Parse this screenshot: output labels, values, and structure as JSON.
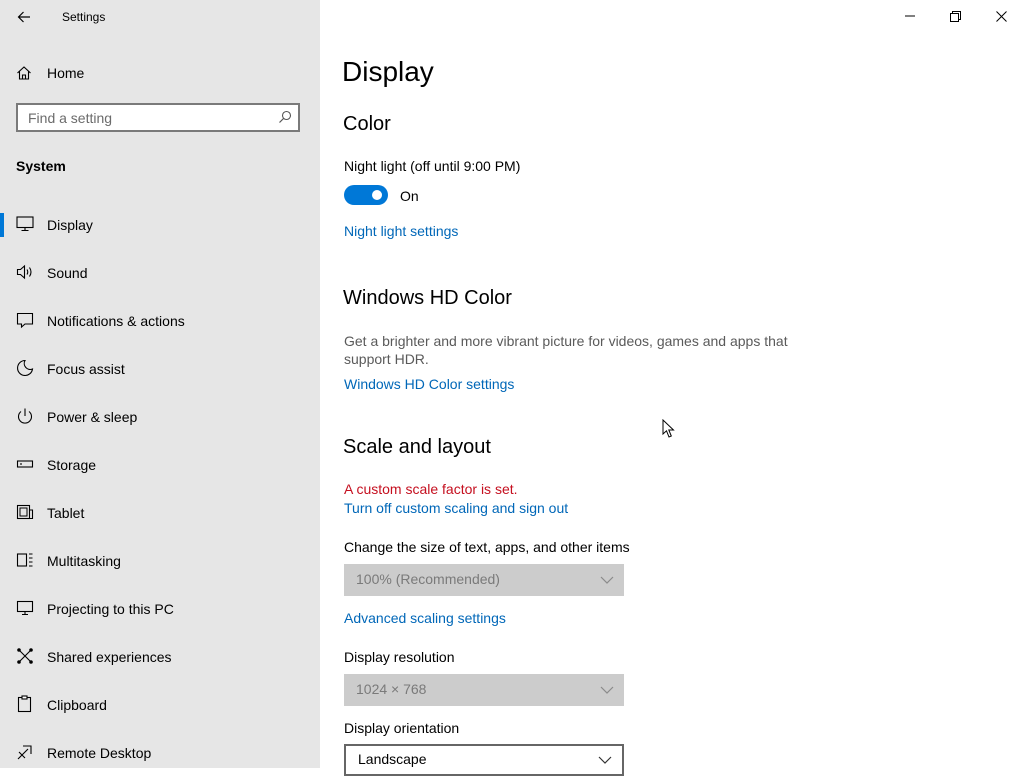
{
  "window": {
    "title": "Settings",
    "controls": {
      "minimize": "minimize",
      "restore": "restore",
      "close": "close"
    }
  },
  "sidebar": {
    "home_label": "Home",
    "search_placeholder": "Find a setting",
    "section_header": "System",
    "items": [
      {
        "label": "Display",
        "icon": "monitor-icon",
        "active": true
      },
      {
        "label": "Sound",
        "icon": "speaker-icon"
      },
      {
        "label": "Notifications & actions",
        "icon": "notification-icon"
      },
      {
        "label": "Focus assist",
        "icon": "moon-icon"
      },
      {
        "label": "Power & sleep",
        "icon": "power-icon"
      },
      {
        "label": "Storage",
        "icon": "storage-icon"
      },
      {
        "label": "Tablet",
        "icon": "tablet-icon"
      },
      {
        "label": "Multitasking",
        "icon": "multitasking-icon"
      },
      {
        "label": "Projecting to this PC",
        "icon": "projecting-icon"
      },
      {
        "label": "Shared experiences",
        "icon": "shared-experiences-icon"
      },
      {
        "label": "Clipboard",
        "icon": "clipboard-icon"
      },
      {
        "label": "Remote Desktop",
        "icon": "remote-desktop-icon"
      }
    ]
  },
  "main": {
    "page_title": "Display",
    "color": {
      "heading": "Color",
      "night_light_label": "Night light (off until 9:00 PM)",
      "toggle_state": "On",
      "night_light_settings_link": "Night light settings"
    },
    "hd_color": {
      "heading": "Windows HD Color",
      "description": "Get a brighter and more vibrant picture for videos, games and apps that support HDR.",
      "settings_link": "Windows HD Color settings"
    },
    "scale_layout": {
      "heading": "Scale and layout",
      "warning": "A custom scale factor is set.",
      "turn_off_link": "Turn off custom scaling and sign out",
      "size_label": "Change the size of text, apps, and other items",
      "size_value": "100% (Recommended)",
      "advanced_link": "Advanced scaling settings",
      "resolution_label": "Display resolution",
      "resolution_value": "1024 × 768",
      "orientation_label": "Display orientation",
      "orientation_value": "Landscape"
    }
  },
  "colors": {
    "accent": "#0078d7",
    "link": "#0067b8",
    "warning": "#c50f1f",
    "sidebar_bg": "#e6e6e6"
  }
}
